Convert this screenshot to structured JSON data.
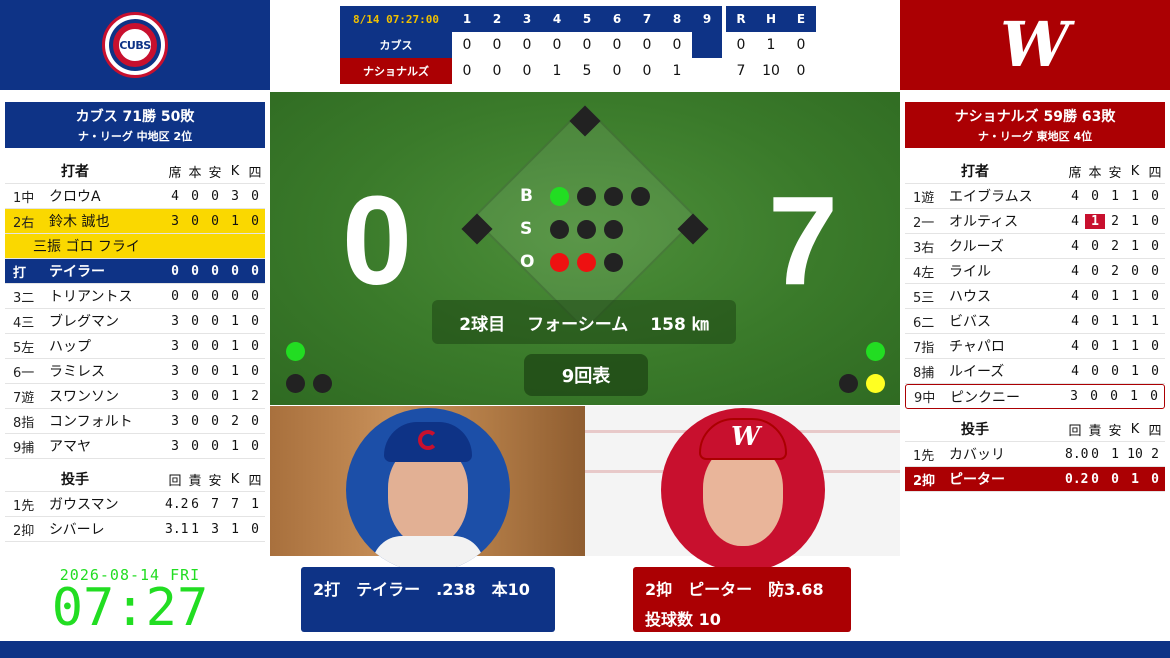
{
  "colors": {
    "cubs_blue": "#0e3386",
    "nats_red": "#ab0003",
    "highlight": "#fad800",
    "field": "#3a7a2a",
    "green": "#22dd22",
    "red": "#ee1111",
    "yellow": "#ffff22"
  },
  "logos": {
    "cubs": "CUBS",
    "nats": "W"
  },
  "linescore": {
    "clock": "8/14 07:27:00",
    "innings": [
      "1",
      "2",
      "3",
      "4",
      "5",
      "6",
      "7",
      "8",
      "9",
      "R",
      "H",
      "E"
    ],
    "away": {
      "name": "カブス",
      "scores": [
        "0",
        "0",
        "0",
        "0",
        "0",
        "0",
        "0",
        "0",
        "",
        "0",
        "1",
        "0"
      ]
    },
    "home": {
      "name": "ナショナルズ",
      "scores": [
        "0",
        "0",
        "0",
        "1",
        "5",
        "0",
        "0",
        "1",
        "",
        "7",
        "10",
        "0"
      ]
    }
  },
  "away_team": {
    "title": "カブス 71勝 50敗",
    "sub": "ナ・リーグ 中地区 2位"
  },
  "home_team": {
    "title": "ナショナルズ 59勝 63敗",
    "sub": "ナ・リーグ 東地区 4位"
  },
  "batting_header": {
    "label": "打者",
    "cols": [
      "席",
      "本",
      "安",
      "K",
      "四"
    ]
  },
  "pitching_header": {
    "label": "投手",
    "cols": [
      "回",
      "責",
      "安",
      "K",
      "四"
    ]
  },
  "away_batters": [
    {
      "pos": "1中",
      "name": "クロウA",
      "s": [
        "4",
        "0",
        "0",
        "3",
        "0"
      ]
    },
    {
      "pos": "2右",
      "name": "鈴木 誠也",
      "s": [
        "3",
        "0",
        "0",
        "1",
        "0"
      ]
    },
    {
      "pos": "打",
      "name": "テイラー",
      "s": [
        "0",
        "0",
        "0",
        "0",
        "0"
      ]
    },
    {
      "pos": "3二",
      "name": "トリアントス",
      "s": [
        "0",
        "0",
        "0",
        "0",
        "0"
      ]
    },
    {
      "pos": "4三",
      "name": "ブレグマン",
      "s": [
        "3",
        "0",
        "0",
        "1",
        "0"
      ]
    },
    {
      "pos": "5左",
      "name": "ハップ",
      "s": [
        "3",
        "0",
        "0",
        "1",
        "0"
      ]
    },
    {
      "pos": "6一",
      "name": "ラミレス",
      "s": [
        "3",
        "0",
        "0",
        "1",
        "0"
      ]
    },
    {
      "pos": "7遊",
      "name": "スワンソン",
      "s": [
        "3",
        "0",
        "0",
        "1",
        "2"
      ]
    },
    {
      "pos": "8指",
      "name": "コンフォルト",
      "s": [
        "3",
        "0",
        "0",
        "2",
        "0"
      ]
    },
    {
      "pos": "9捕",
      "name": "アマヤ",
      "s": [
        "3",
        "0",
        "0",
        "1",
        "0"
      ]
    }
  ],
  "suzuki_results": "三振 ゴロ フライ",
  "away_pitchers": [
    {
      "pos": "1先",
      "name": "ガウスマン",
      "s": [
        "4.2",
        "6",
        "7",
        "7",
        "1"
      ]
    },
    {
      "pos": "2抑",
      "name": "シバーレ",
      "s": [
        "3.1",
        "1",
        "3",
        "1",
        "0"
      ]
    }
  ],
  "home_batters": [
    {
      "pos": "1遊",
      "name": "エイブラムス",
      "s": [
        "4",
        "0",
        "1",
        "1",
        "0"
      ]
    },
    {
      "pos": "2一",
      "name": "オルティス",
      "s": [
        "4",
        "1",
        "2",
        "1",
        "0"
      ]
    },
    {
      "pos": "3右",
      "name": "クルーズ",
      "s": [
        "4",
        "0",
        "2",
        "1",
        "0"
      ]
    },
    {
      "pos": "4左",
      "name": "ライル",
      "s": [
        "4",
        "0",
        "2",
        "0",
        "0"
      ]
    },
    {
      "pos": "5三",
      "name": "ハウス",
      "s": [
        "4",
        "0",
        "1",
        "1",
        "0"
      ]
    },
    {
      "pos": "6二",
      "name": "ビバス",
      "s": [
        "4",
        "0",
        "1",
        "1",
        "1"
      ]
    },
    {
      "pos": "7指",
      "name": "チャパロ",
      "s": [
        "4",
        "0",
        "1",
        "1",
        "0"
      ]
    },
    {
      "pos": "8捕",
      "name": "ルイーズ",
      "s": [
        "4",
        "0",
        "0",
        "1",
        "0"
      ]
    },
    {
      "pos": "9中",
      "name": "ピンクニー",
      "s": [
        "3",
        "0",
        "0",
        "1",
        "0"
      ]
    }
  ],
  "home_pitchers": [
    {
      "pos": "1先",
      "name": "カバッリ",
      "s": [
        "8.0",
        "0",
        "1",
        "10",
        "2"
      ]
    },
    {
      "pos": "2抑",
      "name": "ピーター",
      "s": [
        "0.2",
        "0",
        "0",
        "1",
        "0"
      ]
    }
  ],
  "datetime": {
    "date": "2026-08-14 FRI",
    "time": "07:27"
  },
  "score": {
    "away": "0",
    "home": "7"
  },
  "count": {
    "b_label": "B",
    "s_label": "S",
    "o_label": "O",
    "balls": 1,
    "strikes": 0,
    "outs": 2
  },
  "pitch": {
    "number": "2球目",
    "type": "フォーシーム",
    "speed": "158 ㎞"
  },
  "inning": "9回表",
  "batter_box": {
    "line": "2打　テイラー　.238　本10"
  },
  "pitcher_box": {
    "line1": "2抑　ピーター　防3.68",
    "line2": "投球数 10"
  }
}
